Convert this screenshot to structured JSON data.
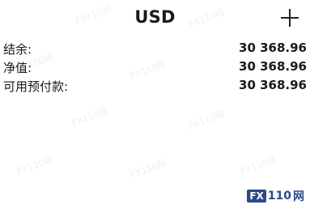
{
  "header": {
    "title": "USD"
  },
  "account": {
    "rows": [
      {
        "label": "结余:",
        "value": "30 368.96"
      },
      {
        "label": "净值:",
        "value": "30 368.96"
      },
      {
        "label": "可用预付款:",
        "value": "30 368.96"
      }
    ]
  },
  "watermark": {
    "text": "FX110网"
  },
  "brand": {
    "fx": "FX",
    "num": "110",
    "cn": "网"
  }
}
